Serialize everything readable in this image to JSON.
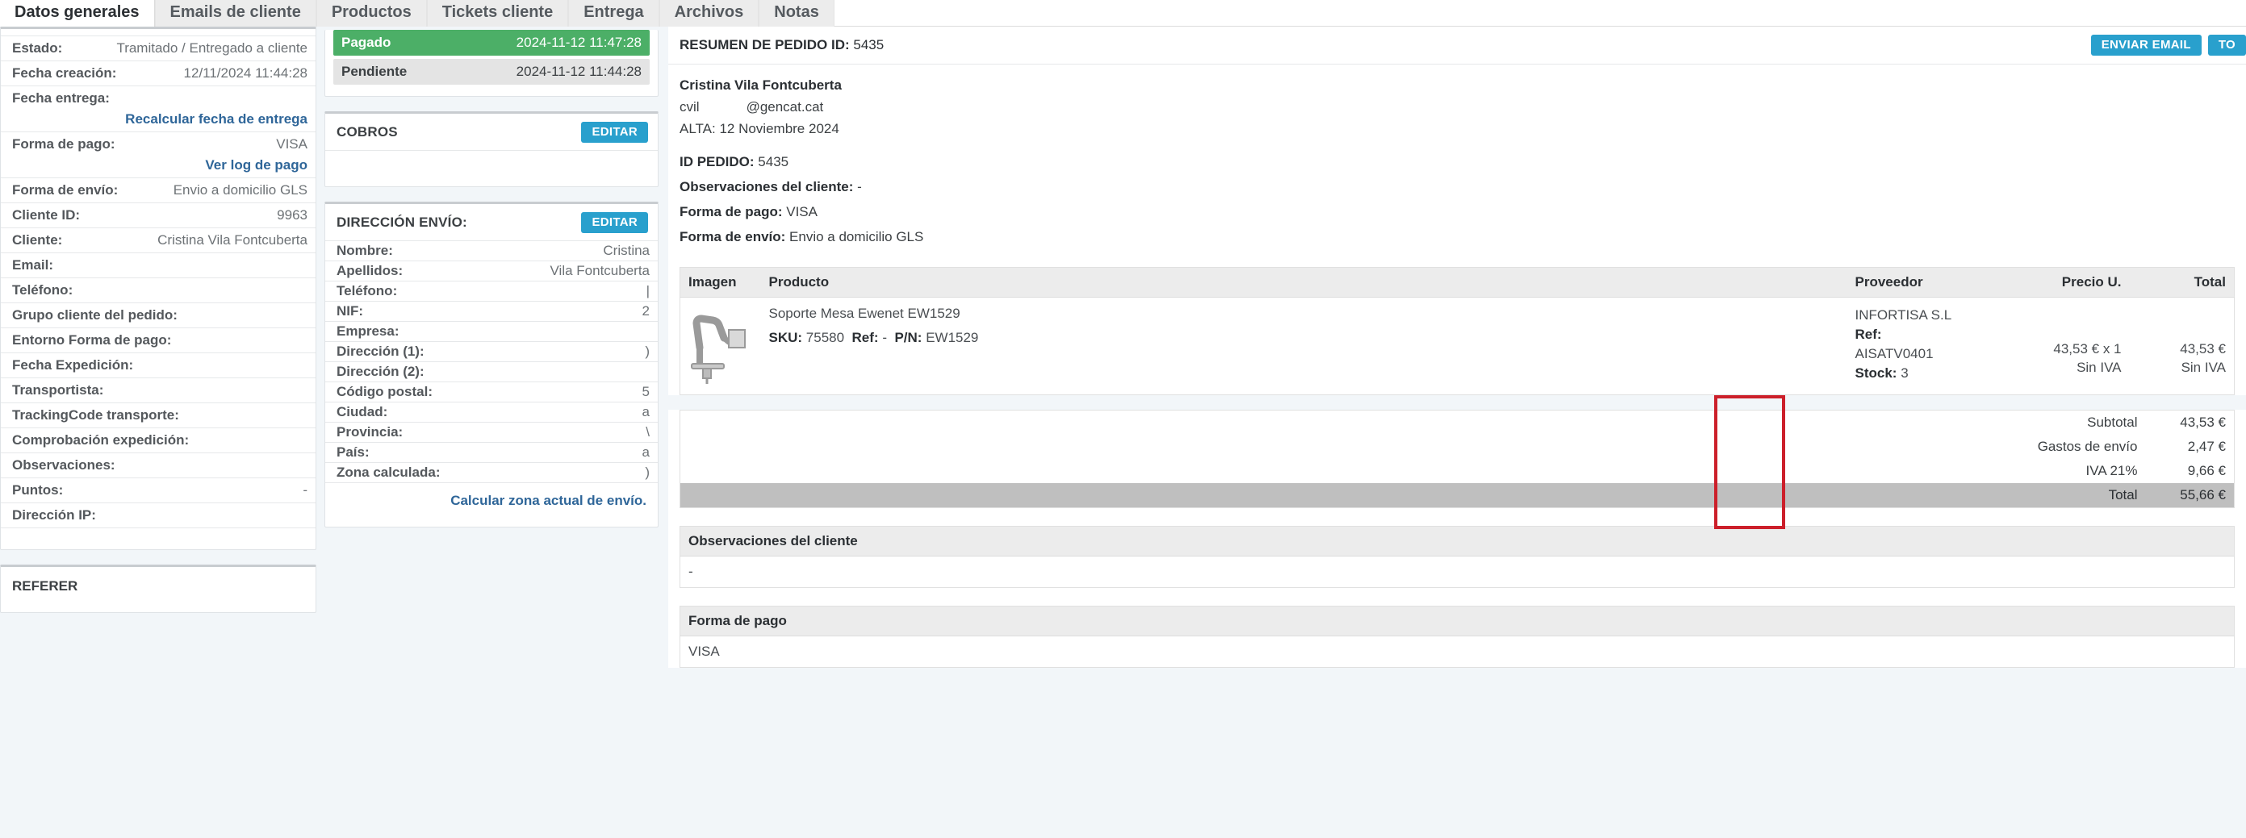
{
  "tabs": [
    {
      "label": "Datos generales",
      "active": true
    },
    {
      "label": "Emails de cliente",
      "active": false
    },
    {
      "label": "Productos",
      "active": false
    },
    {
      "label": "Tickets cliente",
      "active": false
    },
    {
      "label": "Entrega",
      "active": false
    },
    {
      "label": "Archivos",
      "active": false
    },
    {
      "label": "Notas",
      "active": false
    }
  ],
  "colors": {
    "accent_blue": "#29a0cd",
    "link_blue": "#2f6699",
    "paid_green": "#4caf67",
    "pending_grey": "#e4e4e4",
    "highlight_red": "#cc1f2a",
    "total_row_grey": "#bfbfbf"
  },
  "general": {
    "rows": [
      {
        "label": "Estado:",
        "value": "Tramitado / Entregado a cliente",
        "link": false
      },
      {
        "label": "Fecha creación:",
        "value": "12/11/2024 11:44:28",
        "link": false
      },
      {
        "label": "Fecha entrega:",
        "value": "",
        "link": false,
        "extra": "Recalcular fecha de entrega",
        "extra_link": true
      },
      {
        "label": "Forma de pago:",
        "value": "VISA",
        "link": false,
        "extra": "Ver log de pago",
        "extra_link": true
      },
      {
        "label": "Forma de envío:",
        "value": "Envio a domicilio GLS",
        "link": false
      },
      {
        "label": "Cliente ID:",
        "value": "9963",
        "link": false
      },
      {
        "label": "Cliente:",
        "value": "Cristina Vila Fontcuberta",
        "link": false
      },
      {
        "label": "Email:",
        "value": "",
        "link": false
      },
      {
        "label": "Teléfono:",
        "value": "",
        "link": false
      },
      {
        "label": "Grupo cliente del pedido:",
        "value": "",
        "link": false
      },
      {
        "label": "Entorno Forma de pago:",
        "value": "",
        "link": false
      },
      {
        "label": "Fecha Expedición:",
        "value": "",
        "link": false
      },
      {
        "label": "Transportista:",
        "value": "",
        "link": false
      },
      {
        "label": "TrackingCode transporte:",
        "value": "",
        "link": false
      },
      {
        "label": "Comprobación expedición:",
        "value": "",
        "link": false
      },
      {
        "label": "Observaciones:",
        "value": "",
        "link": false
      },
      {
        "label": "Puntos:",
        "value": "-",
        "link": false
      },
      {
        "label": "Dirección IP:",
        "value": "",
        "link": false
      }
    ]
  },
  "referer": {
    "title": "REFERER"
  },
  "payment_status": {
    "rows": [
      {
        "label": "Pagado",
        "timestamp": "2024-11-12 11:47:28",
        "state": "paid"
      },
      {
        "label": "Pendiente",
        "timestamp": "2024-11-12 11:44:28",
        "state": "pending"
      }
    ]
  },
  "cobros": {
    "title": "COBROS",
    "edit_label": "EDITAR"
  },
  "direccion_envio": {
    "title": "DIRECCIÓN ENVÍO:",
    "edit_label": "EDITAR",
    "rows": [
      {
        "label": "Nombre:",
        "value": "Cristina"
      },
      {
        "label": "Apellidos:",
        "value": "Vila Fontcuberta"
      },
      {
        "label": "Teléfono:",
        "value": "|"
      },
      {
        "label": "NIF:",
        "value": "2"
      },
      {
        "label": "Empresa:",
        "value": ""
      },
      {
        "label": "Dirección (1):",
        "value": ")"
      },
      {
        "label": "Dirección (2):",
        "value": ""
      },
      {
        "label": "Código postal:",
        "value": "5"
      },
      {
        "label": "Ciudad:",
        "value": "a"
      },
      {
        "label": "Provincia:",
        "value": "\\"
      },
      {
        "label": "País:",
        "value": "a"
      },
      {
        "label": "Zona calculada:",
        "value": ")"
      }
    ],
    "calc_link": "Calcular zona actual de envío."
  },
  "resumen": {
    "title_label": "RESUMEN DE PEDIDO ID:",
    "order_id": "5435",
    "buttons": [
      {
        "label": "ENVIAR EMAIL"
      },
      {
        "label": "TO"
      }
    ],
    "customer_name": "Cristina  Vila Fontcuberta",
    "customer_email_prefix": "cvil",
    "customer_email_suffix": "@gencat.cat",
    "alta_line": "ALTA: 12 Noviembre 2024",
    "meta": [
      {
        "label": "ID PEDIDO:",
        "value": "5435"
      },
      {
        "label": "Observaciones del cliente:",
        "value": "-"
      },
      {
        "label": "Forma de pago:",
        "value": "VISA"
      },
      {
        "label": "Forma de envío:",
        "value": "Envio a domicilio GLS"
      }
    ]
  },
  "product_table": {
    "headers": [
      "Imagen",
      "Producto",
      "Proveedor",
      "Precio U.",
      "Total"
    ],
    "rows": [
      {
        "image_icon": "monitor-arm-mount",
        "name": "Soporte Mesa Ewenet EW1529",
        "sku_label": "SKU:",
        "sku": "75580",
        "ref_label": "Ref:",
        "ref": "-",
        "pn_label": "P/N:",
        "pn": "EW1529",
        "provider_name": "INFORTISA S.L",
        "provider_ref_label": "Ref:",
        "provider_ref": "AISATV0401",
        "provider_stock_label": "Stock:",
        "provider_stock": "3",
        "unit_price": "43,53 €  x 1",
        "unit_price_note": "Sin IVA",
        "total": "43,53 €",
        "total_note": "Sin IVA"
      }
    ]
  },
  "totals": {
    "rows": [
      {
        "label": "Subtotal",
        "value": "43,53 €",
        "grand": false
      },
      {
        "label": "Gastos de envío",
        "value": "2,47 €",
        "grand": false
      },
      {
        "label": "IVA 21%",
        "value": "9,66 €",
        "grand": false
      },
      {
        "label": "Total",
        "value": "55,66 €",
        "grand": true
      }
    ]
  },
  "observaciones": {
    "header": "Observaciones del cliente",
    "value": "-"
  },
  "forma_pago": {
    "header": "Forma de pago",
    "value": "VISA"
  }
}
